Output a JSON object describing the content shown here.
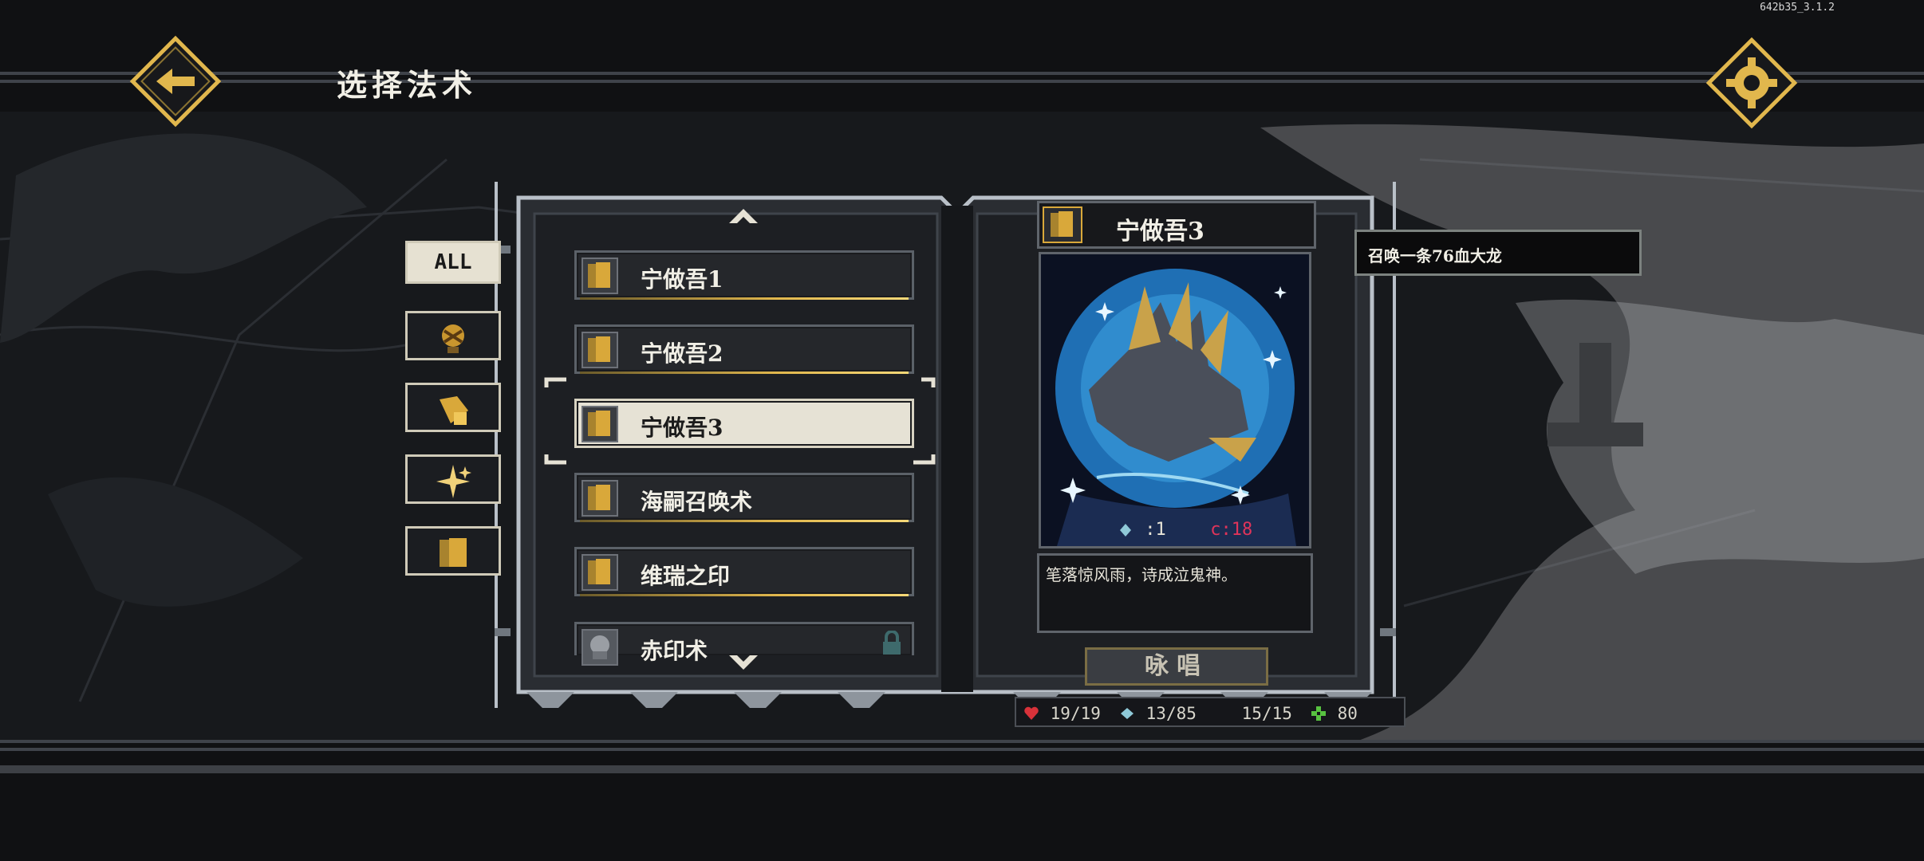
{
  "version": "642b35_3.1.2",
  "header": {
    "title": "选择法术",
    "back_icon": "back-arrow-icon",
    "settings_icon": "gear-icon"
  },
  "tabs": [
    {
      "label": "ALL",
      "icon": ""
    },
    {
      "label": "",
      "icon": "summon-icon"
    },
    {
      "label": "",
      "icon": "scroll-icon"
    },
    {
      "label": "",
      "icon": "sparkle-icon"
    },
    {
      "label": "",
      "icon": "card-icon"
    }
  ],
  "spells": [
    {
      "name": "宁做吾1",
      "icon": "card-icon"
    },
    {
      "name": "宁做吾2",
      "icon": "card-icon"
    },
    {
      "name": "宁做吾3",
      "icon": "card-icon",
      "selected": true
    },
    {
      "name": "海嗣召唤术",
      "icon": "card-icon"
    },
    {
      "name": "维瑞之印",
      "icon": "card-icon"
    },
    {
      "name": "赤印术",
      "icon": "locked-spell-icon",
      "locked": true
    }
  ],
  "card": {
    "title": "宁做吾3",
    "cost_a": ":1",
    "cost_b": "c:18",
    "flavor": "笔落惊风雨，诗成泣鬼神。",
    "cast_label": "咏唱"
  },
  "tooltip": {
    "text": "召唤一条76血大龙"
  },
  "resources": {
    "hp": "19/19",
    "crystal": "13/85",
    "mana": "15/15",
    "clover": "80"
  },
  "colors": {
    "gold": "#e1b74d",
    "panel": "#25272b",
    "selected": "#e6e2d5",
    "hp": "#d8323a",
    "mana": "#c23fd6",
    "clover": "#57c240",
    "crystal": "#8fc9d8"
  }
}
